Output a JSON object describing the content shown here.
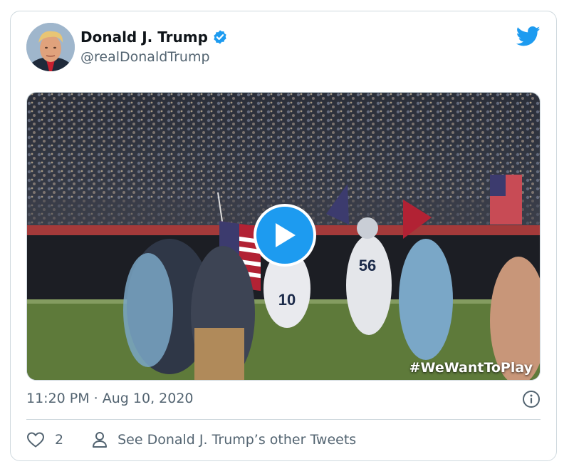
{
  "tweet": {
    "author": {
      "display_name": "Donald J. Trump",
      "handle": "@realDonaldTrump",
      "verified": true
    },
    "media": {
      "type": "video",
      "overlay_text": "#WeWantToPlay",
      "jersey_numbers": [
        "10",
        "56"
      ]
    },
    "timestamp": "11:20 PM · Aug 10, 2020",
    "actions": {
      "like_count": "2",
      "profile_link_label": "See Donald J. Trump’s other Tweets"
    }
  },
  "colors": {
    "brand": "#1d9bf0",
    "secondary_text": "#536471",
    "border": "#cfd9de"
  },
  "icons": [
    "twitter-bird-icon",
    "verified-badge-icon",
    "play-icon",
    "info-icon",
    "heart-icon",
    "person-icon"
  ]
}
